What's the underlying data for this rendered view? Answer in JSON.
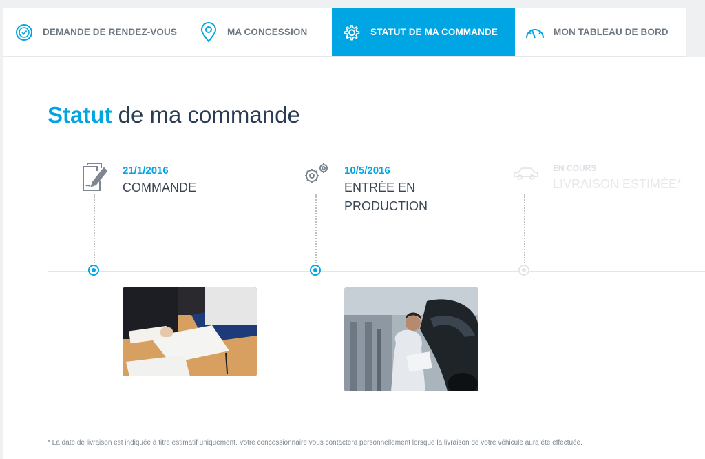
{
  "nav": {
    "tabs": [
      {
        "label": "DEMANDE DE RENDEZ-VOUS",
        "icon": "clock-icon"
      },
      {
        "label": "MA CONCESSION",
        "icon": "location-pin-icon"
      },
      {
        "label": "STATUT DE MA COMMANDE",
        "icon": "gear-icon",
        "active": true
      },
      {
        "label": "MON TABLEAU DE BORD",
        "icon": "speedometer-icon"
      }
    ]
  },
  "page": {
    "title_strong": "Statut",
    "title_rest": " de ma commande"
  },
  "timeline": {
    "steps": [
      {
        "date": "21/1/2016",
        "label": "COMMANDE",
        "icon": "document-signature-icon",
        "photo": "contract-signing-photo",
        "done": true
      },
      {
        "date": "10/5/2016",
        "label_line1": "ENTRÉE EN",
        "label_line2": "PRODUCTION",
        "icon": "gears-icon",
        "photo": "factory-worker-photo",
        "done": true
      },
      {
        "date": "EN COURS",
        "label": "LIVRAISON ESTIMÉE*",
        "icon": "car-icon",
        "done": false
      }
    ]
  },
  "footer": {
    "note": "* La date de livraison est indiquée à titre estimatif uniquement. Votre concessionnaire vous contactera personnellement lorsque la livraison de votre véhicule aura été effectuée."
  },
  "colors": {
    "accent": "#00a6e3",
    "text": "#2a3d55",
    "muted": "#6b7680"
  }
}
